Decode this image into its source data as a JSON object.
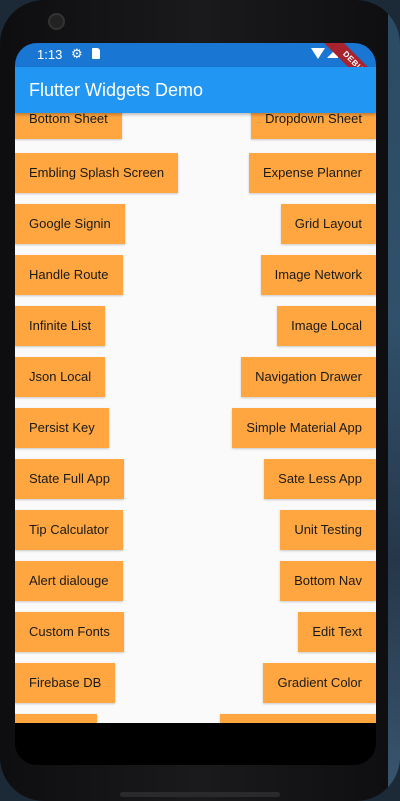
{
  "status_bar": {
    "time": "1:13"
  },
  "debug_banner": "DEBUG",
  "app_bar": {
    "title": "Flutter Widgets Demo"
  },
  "buttons": {
    "left": [
      "Bottom Sheet",
      "Embling Splash Screen",
      "Google Signin",
      "Handle Route",
      "Infinite List",
      "Json Local",
      "Persist Key",
      "State Full App",
      "Tip Calculator",
      "Alert dialouge",
      "Custom Fonts",
      "Firebase DB",
      ""
    ],
    "right": [
      "Dropdown Sheet",
      "Expense Planner",
      "Grid Layout",
      "Image Network",
      "Image Local",
      "Navigation Drawer",
      "Simple Material App",
      "Sate Less App",
      "Unit Testing",
      "Bottom Nav",
      "Edit Text",
      "Gradient Color",
      ""
    ]
  },
  "colors": {
    "app_bar": "#2196f3",
    "status_bar": "#1976d2",
    "button": "#ffa640",
    "background": "#fafafa"
  }
}
